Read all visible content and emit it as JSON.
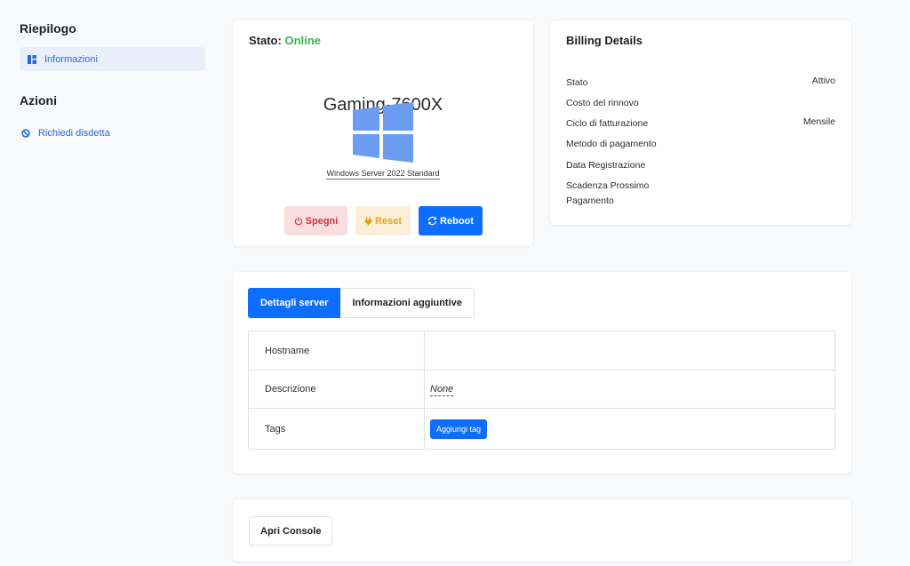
{
  "sidebar": {
    "summary_heading": "Riepilogo",
    "summary_items": [
      {
        "label": "Informazioni",
        "icon": "dashboard-icon"
      }
    ],
    "actions_heading": "Azioni",
    "action_items": [
      {
        "label": "Richiedi disdetta",
        "icon": "ban-icon"
      }
    ]
  },
  "status_card": {
    "status_label": "Stato:",
    "status_value": "Online",
    "status_color": "#3fb24a",
    "server_name": "Gaming-7600X",
    "os_icon": "windows-logo-icon",
    "os_name": "Windows Server 2022 Standard",
    "buttons": {
      "shutdown": "Spegni",
      "reset": "Reset",
      "reboot": "Reboot"
    }
  },
  "billing": {
    "title": "Billing Details",
    "rows": [
      {
        "label": "Stato",
        "value": "Attivo"
      },
      {
        "label": "Costo del rinnovo",
        "value": ""
      },
      {
        "label": "Ciclo di fatturazione",
        "value": "Mensile"
      },
      {
        "label": "Metodo di pagamento",
        "value": ""
      },
      {
        "label": "Data Registrazione",
        "value": ""
      },
      {
        "label": "Scadenza Prossimo Pagamento",
        "value": ""
      }
    ]
  },
  "server_details": {
    "tabs": [
      {
        "label": "Dettagli server"
      },
      {
        "label": "Informazioni aggiuntive"
      }
    ],
    "hostname_label": "Hostname",
    "hostname_value": "",
    "description_label": "Descrizione",
    "description_value": "None",
    "tags_label": "Tags",
    "add_tag_label": "Aggiungi tag"
  },
  "console": {
    "open_label": "Apri Console"
  },
  "colors": {
    "primary": "#0d6efd",
    "danger_bg": "#f8dede",
    "danger_text": "#d9343d",
    "warning_bg": "#fbefd7",
    "warning_text": "#e5a21b",
    "windows_blue": "#6b9cf1"
  }
}
